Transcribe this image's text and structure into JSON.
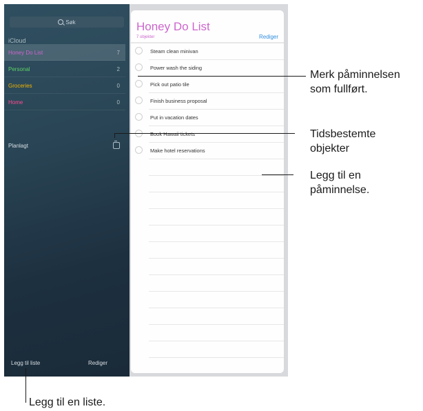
{
  "sidebar": {
    "search_placeholder": "Søk",
    "section": "iCloud",
    "lists": [
      {
        "name": "Honey Do List",
        "count": "7",
        "color": "#cc66cc"
      },
      {
        "name": "Personal",
        "count": "2",
        "color": "#5fd068"
      },
      {
        "name": "Groceries",
        "count": "0",
        "color": "#f2b400"
      },
      {
        "name": "Home",
        "count": "0",
        "color": "#ff4b8f"
      }
    ],
    "scheduled": "Planlagt",
    "add_list": "Legg til liste",
    "edit": "Rediger"
  },
  "panel": {
    "title": "Honey Do List",
    "subtitle": "7 objekter",
    "edit": "Rediger",
    "items": [
      "Steam clean minivan",
      "Power wash the siding",
      "Pick out patio tile",
      "Finish business proposal",
      "Put in vacation dates",
      "Book Hawaii tickets",
      "Make hotel reservations"
    ]
  },
  "callouts": {
    "mark_done": [
      "Merk påminnelsen",
      "som fullført."
    ],
    "scheduled": [
      "Tidsbestemte",
      "objekter"
    ],
    "add_reminder": [
      "Legg til en",
      "påminnelse."
    ],
    "add_list": "Legg til en liste."
  }
}
